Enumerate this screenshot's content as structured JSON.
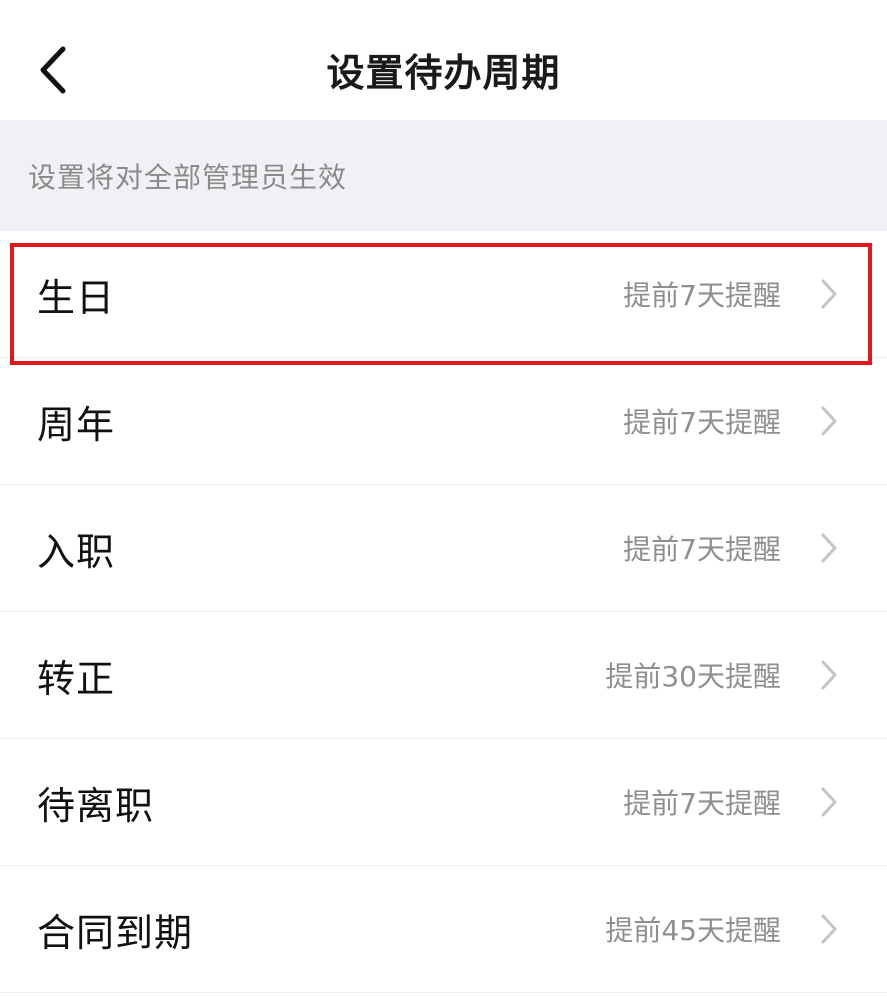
{
  "header": {
    "title": "设置待办周期",
    "back_icon": "chevron-left-icon"
  },
  "notice": {
    "text": "设置将对全部管理员生效"
  },
  "items": [
    {
      "label": "生日",
      "value": "提前7天提醒",
      "highlighted": true
    },
    {
      "label": "周年",
      "value": "提前7天提醒"
    },
    {
      "label": "入职",
      "value": "提前7天提醒"
    },
    {
      "label": "转正",
      "value": "提前30天提醒"
    },
    {
      "label": "待离职",
      "value": "提前7天提醒"
    },
    {
      "label": "合同到期",
      "value": "提前45天提醒"
    }
  ],
  "colors": {
    "highlight": "#e0191e",
    "band": "#f1f1f5",
    "value_text": "#8f8f8f"
  }
}
